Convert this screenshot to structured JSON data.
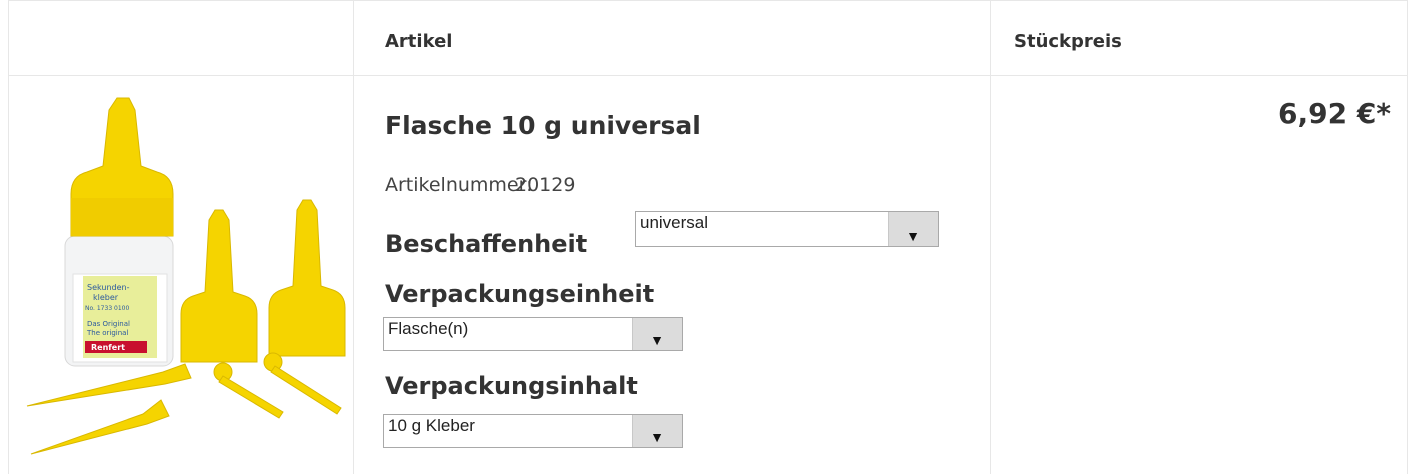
{
  "table": {
    "headers": {
      "article": "Artikel",
      "unit_price": "Stückpreis"
    }
  },
  "product": {
    "title": "Flasche 10 g universal",
    "article_number_label": "Artikelnummer:",
    "article_number": "20129",
    "options": [
      {
        "label": "Beschaffenheit",
        "selected": "universal"
      },
      {
        "label": "Verpackungseinheit",
        "selected": "Flasche(n)"
      },
      {
        "label": "Verpackungsinhalt",
        "selected": "10 g Kleber"
      }
    ],
    "price": "6,92 €*",
    "image_label_lines": [
      "Sekunden-",
      "kleber",
      "No. 1733 0100",
      "Das Original",
      "The original"
    ],
    "image_brand": "Renfert"
  },
  "colors": {
    "yellow": "#f5d400",
    "border": "#e7e7e7",
    "text": "#333333",
    "brand_red": "#c8102e"
  },
  "icons": {
    "dropdown": "triangle-down"
  }
}
